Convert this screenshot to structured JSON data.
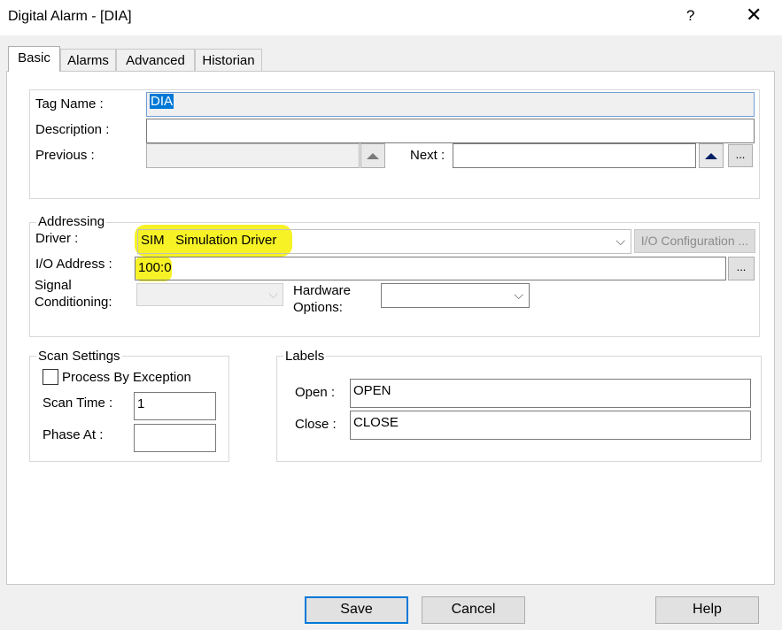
{
  "window": {
    "title": "Digital Alarm - [DIA]",
    "help_glyph": "?",
    "close_glyph": "✕"
  },
  "tabs": [
    {
      "label": "Basic"
    },
    {
      "label": "Alarms"
    },
    {
      "label": "Advanced"
    },
    {
      "label": "Historian"
    }
  ],
  "tag": {
    "tag_name_label": "Tag Name :",
    "tag_name_value": "DIA",
    "description_label": "Description :",
    "description_value": "",
    "previous_label": "Previous :",
    "previous_value": "",
    "next_label": "Next :",
    "next_value": "",
    "browse_label": "..."
  },
  "addressing": {
    "legend": "Addressing",
    "driver_label": "Driver :",
    "driver_value": "SIM   Simulation Driver",
    "io_config_label": "I/O Configuration ...",
    "io_address_label": "I/O Address :",
    "io_address_value": "100:0",
    "browse_label": "...",
    "signal_label_1": "Signal",
    "signal_label_2": "Conditioning:",
    "signal_value": "",
    "hardware_label_1": "Hardware",
    "hardware_label_2": "Options:",
    "hardware_value": ""
  },
  "scan": {
    "legend": "Scan Settings",
    "pbe_label": "Process By Exception",
    "pbe_checked": false,
    "scan_time_label": "Scan Time :",
    "scan_time_value": "1",
    "phase_label": "Phase At :",
    "phase_value": ""
  },
  "labels": {
    "legend": "Labels",
    "open_label": "Open :",
    "open_value": "OPEN",
    "close_label": "Close :",
    "close_value": "CLOSE"
  },
  "buttons": {
    "save": "Save",
    "cancel": "Cancel",
    "help": "Help"
  }
}
